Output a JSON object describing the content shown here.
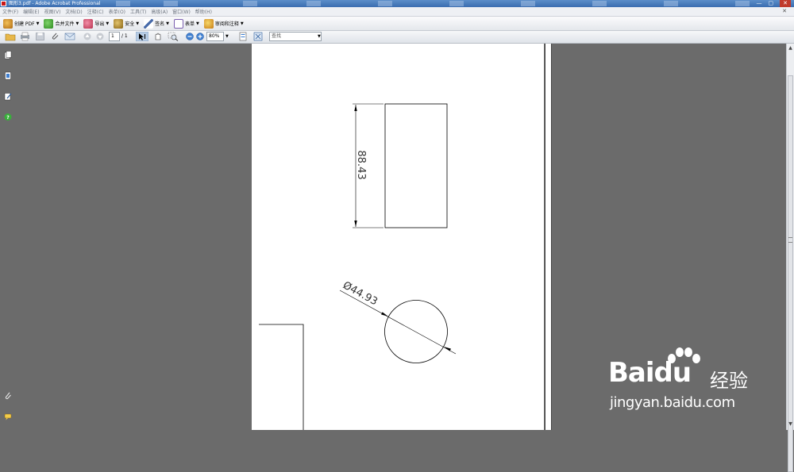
{
  "window": {
    "title": "图形3.pdf - Adobe Acrobat Professional",
    "controls": [
      "—",
      "▢",
      "✕"
    ]
  },
  "menu": {
    "items": [
      "文件(F)",
      "编辑(E)",
      "视图(V)",
      "文档(D)",
      "注释(C)",
      "表单(O)",
      "工具(T)",
      "高级(A)",
      "窗口(W)",
      "帮助(H)"
    ],
    "close_doc": "✕"
  },
  "toolbar": {
    "create_pdf": "创建 PDF",
    "combine": "合并文件",
    "export": "导出",
    "secure": "安全",
    "sign": "签名",
    "forms": "表单",
    "review": "审阅和注释"
  },
  "nav": {
    "page_current": "1",
    "page_total": "/ 1",
    "zoom": "80%",
    "search_placeholder": "查找"
  },
  "drawing": {
    "rect_dimension": "88.43",
    "circle_dimension": "Ø44.93"
  },
  "watermark": {
    "brand": "Bai",
    "brand2": "du",
    "jingyan": "经验",
    "url": "jingyan.baidu.com"
  },
  "colors": {
    "accent": "#3a6db0",
    "doc_background": "#6b6b6b",
    "page": "#ffffff"
  }
}
